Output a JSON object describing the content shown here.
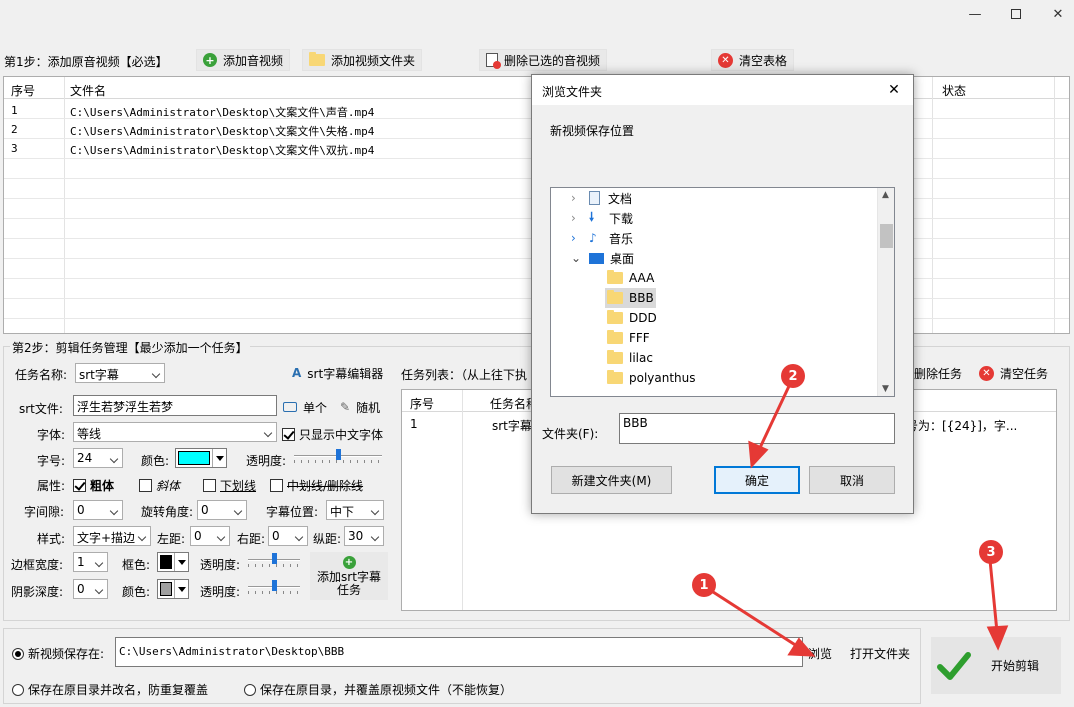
{
  "window": {
    "minimize_icon": "minimize-icon",
    "maximize_icon": "maximize-icon",
    "close_icon": "close-icon"
  },
  "step1": {
    "label": "第1步：添加原音视频【必选】",
    "add_av_label": "添加音视频",
    "add_folder_label": "添加视频文件夹",
    "delete_selected_label": "删除已选的音视频",
    "clear_table_label": "清空表格"
  },
  "file_table": {
    "columns": [
      "序号",
      "文件名",
      "状态"
    ],
    "rows": [
      {
        "index": "1",
        "filename": "C:\\Users\\Administrator\\Desktop\\文案文件\\声音.mp4"
      },
      {
        "index": "2",
        "filename": "C:\\Users\\Administrator\\Desktop\\文案文件\\失格.mp4"
      },
      {
        "index": "3",
        "filename": "C:\\Users\\Administrator\\Desktop\\文案文件\\双抗.mp4"
      }
    ]
  },
  "step2": {
    "label": "第2步：剪辑任务管理【最少添加一个任务】",
    "task_name_label": "任务名称:",
    "task_name_value": "srt字幕",
    "srt_editor_label": "srt字幕编辑器",
    "srt_file_label": "srt文件:",
    "srt_file_value": "浮生若梦浮生若梦",
    "single_label": "单个",
    "random_label": "随机",
    "font_label": "字体:",
    "font_value": "等线",
    "only_chinese_label": "只显示中文字体",
    "size_label": "字号:",
    "size_value": "24",
    "color_label": "颜色:",
    "text_color": "#00ffff",
    "opacity_label": "透明度:",
    "attr_label": "属性:",
    "bold_label": "粗体",
    "italic_label": "斜体",
    "underline_label": "下划线",
    "strike_label": "中划线/删除线",
    "spacing_label": "字间隙:",
    "spacing_value": "0",
    "rotation_label": "旋转角度:",
    "rotation_value": "0",
    "position_label": "字幕位置:",
    "position_value": "中下",
    "style_label": "样式:",
    "style_value": "文字+描边",
    "left_label": "左距:",
    "left_value": "0",
    "right_label": "右距:",
    "right_value": "0",
    "vertical_label": "纵距:",
    "vertical_value": "30",
    "border_width_label": "边框宽度:",
    "border_width_value": "1",
    "border_color_label": "框色:",
    "border_color": "#000000",
    "border_opacity_label": "透明度:",
    "shadow_depth_label": "阴影深度:",
    "shadow_depth_value": "0",
    "shadow_color_label": "颜色:",
    "shadow_color": "#a0a0a0",
    "shadow_opacity_label": "透明度:",
    "add_task_label": "添加srt字幕任务",
    "task_list_label": "任务列表：（从上往下执",
    "delete_task_label": "删除任务",
    "clear_task_label": "清空任务",
    "task_columns": [
      "序号",
      "任务名称"
    ],
    "task_rows": [
      {
        "index": "1",
        "name": "srt字幕",
        "params": "号为：[{24}]，字..."
      }
    ]
  },
  "save": {
    "new_save_label": "新视频保存在:",
    "path_value": "C:\\Users\\Administrator\\Desktop\\BBB",
    "browse_label": "浏览",
    "open_folder_label": "打开文件夹",
    "option_rename_label": "保存在原目录并改名，防重复覆盖",
    "option_overwrite_label": "保存在原目录，并覆盖原视频文件（不能恢复）",
    "start_label": "开始剪辑"
  },
  "dialog": {
    "title": "浏览文件夹",
    "description": "新视频保存位置",
    "tree": [
      {
        "label": "文档",
        "icon": "document-icon"
      },
      {
        "label": "下载",
        "icon": "download-icon"
      },
      {
        "label": "音乐",
        "icon": "music-icon"
      },
      {
        "label": "桌面",
        "icon": "desktop-icon"
      },
      {
        "label": "AAA",
        "icon": "folder-icon"
      },
      {
        "label": "BBB",
        "icon": "folder-icon"
      },
      {
        "label": "DDD",
        "icon": "folder-icon"
      },
      {
        "label": "FFF",
        "icon": "folder-icon"
      },
      {
        "label": "lilac",
        "icon": "folder-icon"
      },
      {
        "label": "polyanthus",
        "icon": "folder-icon"
      }
    ],
    "folder_label": "文件夹(F):",
    "folder_value": "BBB",
    "new_folder_label": "新建文件夹(M)",
    "ok_label": "确定",
    "cancel_label": "取消"
  },
  "markers": [
    "1",
    "2",
    "3"
  ]
}
